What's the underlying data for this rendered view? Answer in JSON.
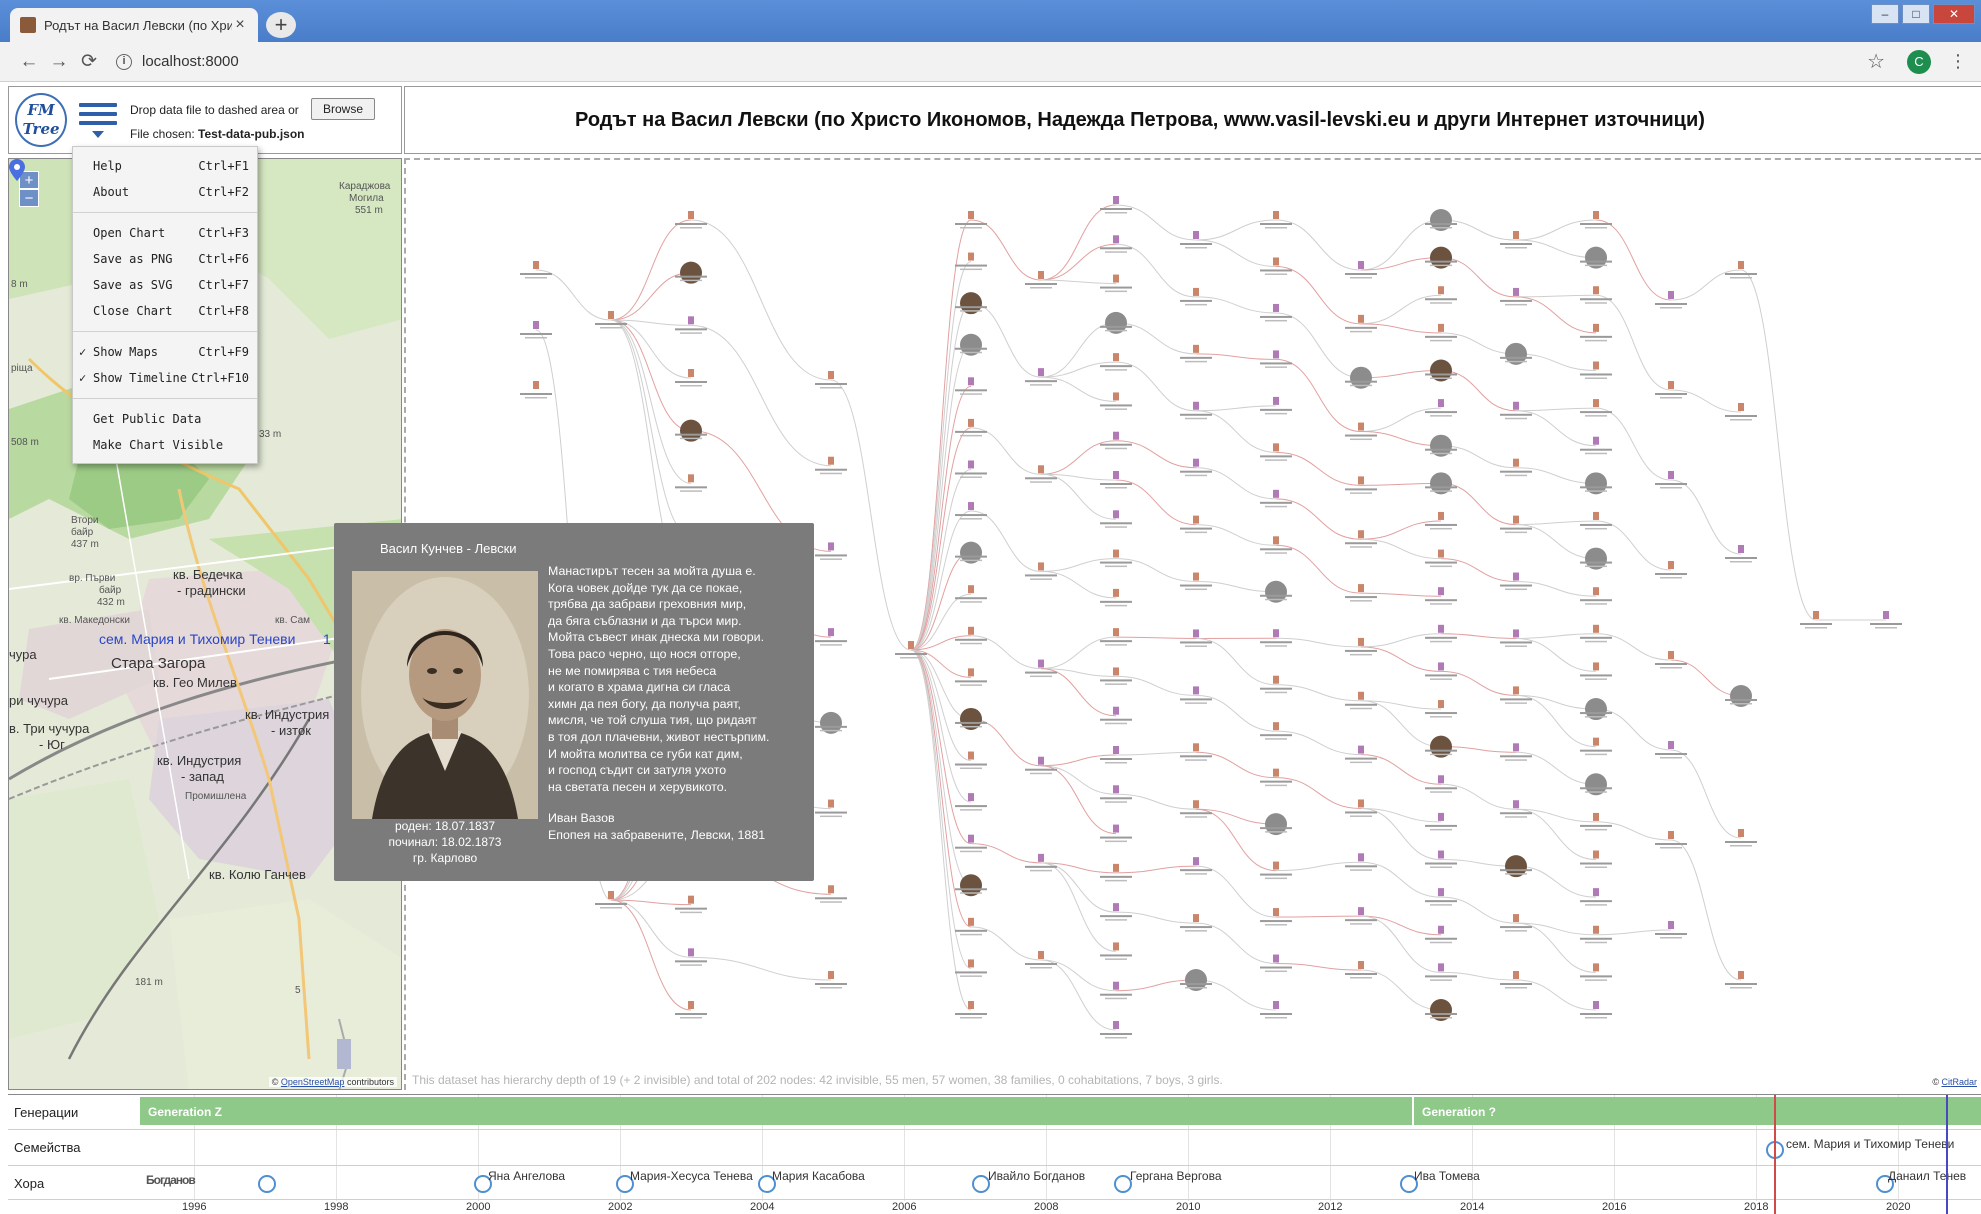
{
  "browser": {
    "tab_title": "Родът на Васил Левски (по Хри",
    "tab_close": "×",
    "new_tab": "+",
    "url": "localhost:8000",
    "profile_initial": "C",
    "minimize": "–",
    "maximize": "□",
    "close": "✕"
  },
  "header": {
    "logo_line1": "FM",
    "logo_line2": "Tree",
    "drop_hint": "Drop data file to dashed area or",
    "browse_label": "Browse",
    "file_chosen_label": "File chosen:",
    "file_chosen_value": "Test-data-pub.json",
    "title": "Родът на Васил Левски (по Христо Икономов, Надежда Петрова, www.vasil-levski.eu и други Интернет източници)"
  },
  "menu": {
    "items": [
      {
        "label": "Help",
        "shortcut": "Ctrl+F1",
        "checked": ""
      },
      {
        "label": "About",
        "shortcut": "Ctrl+F2",
        "checked": ""
      },
      {
        "label": "Open Chart",
        "shortcut": "Ctrl+F3",
        "checked": ""
      },
      {
        "label": "Save as PNG",
        "shortcut": "Ctrl+F6",
        "checked": ""
      },
      {
        "label": "Save as SVG",
        "shortcut": "Ctrl+F7",
        "checked": ""
      },
      {
        "label": "Close Chart",
        "shortcut": "Ctrl+F8",
        "checked": ""
      },
      {
        "label": "Show Maps",
        "shortcut": "Ctrl+F9",
        "checked": "✓"
      },
      {
        "label": "Show Timeline",
        "shortcut": "Ctrl+F10",
        "checked": "✓"
      },
      {
        "label": "Get Public Data",
        "shortcut": "",
        "checked": ""
      },
      {
        "label": "Make Chart Visible",
        "shortcut": "",
        "checked": ""
      }
    ]
  },
  "map": {
    "labels": {
      "karadzhova": "Караджова",
      "mogila": "Могила",
      "m551": "551 m",
      "m8": "8 m",
      "richa": "ріща",
      "m508": "508 m",
      "m33": "33 m",
      "vtori": "Втори",
      "bair": "байр",
      "m437": "437 m",
      "parvi": "вр. Първи",
      "bair2": "байр",
      "m432": "432 m",
      "bedechka": "кв. Бедечка",
      "gradinski": "- градински",
      "makedonski": "кв. Македонски",
      "sam": "кв. Сам",
      "family": "сем. Мария и Тихомир Теневи",
      "family_1": "1",
      "chura": "чура",
      "stara_zagora": "Стара Загора",
      "geo_milev": "кв. Гео Милев",
      "chuchura": "ри чучура",
      "tri_chuchura": "в. Три чучура",
      "yug": "- Юг",
      "industria_iztok": "кв. Индустрия",
      "iztok": "- изток",
      "industria_zapad": "кв. Индустрия",
      "zapad": "- запад",
      "promishlena": "Промишлена",
      "kolyu": "кв. Колю Ганчев",
      "m181": "181 m",
      "road5": "5"
    },
    "attribution_prefix": "©",
    "attribution_link": "OpenStreetMap",
    "attribution_suffix": "contributors",
    "zoom_in": "+",
    "zoom_out": "−"
  },
  "card": {
    "name": "Васил Кунчев - Левски",
    "born": "роден: 18.07.1837",
    "died": "починал: 18.02.1873",
    "place": "гр. Карлово",
    "poem": [
      "Манастирът тесен за мойта душа е.",
      "Кога човек дойде тук да се покае,",
      "трябва да забрави грехов­ния мир,",
      "да бяга съблазни и да търси мир.",
      "Мойта съвест инак днеска ми говори.",
      "Това расо черно, що нося отгоре,",
      "не ме помирява с тия небеса",
      "и когато в храма дигна си гласа",
      "химн да пея богу, да получа раят,",
      "мисля, че той слуша тия, що ридаят",
      "в тоя дол плачевни, живот нестърпим.",
      "И мойта молитва се губи кат дим,",
      "и господ съдит си затуля ухото",
      "на светата песен и херувикото."
    ],
    "ellipsis": "...",
    "author": "Иван Вазов",
    "source": "Епопея на забравените, Левски, 1881"
  },
  "chart": {
    "stats": "This dataset has hierarchy depth of 19 (+ 2 invisible) and total of 202 nodes: 42 invisible, 55 men, 57 women, 38 families, 0 cohabitations, 7 boys, 3 girls.",
    "attribution_prefix": "©",
    "attribution_link": "CitRadar"
  },
  "timeline": {
    "rows": {
      "generations": "Генерации",
      "families": "Семейства",
      "people": "Хора"
    },
    "generations": [
      "Generation Z",
      "Generation ?"
    ],
    "family_labels": [
      "сем. Мария и Тихомир Теневи"
    ],
    "people_labels": [
      "Яна Ангелова",
      "Мария-Хесуса Тенева",
      "Мария Касабова",
      "Ивайло Богданов",
      "Гергана Вергова",
      "Ива Томева",
      "Данаил Тенев"
    ],
    "overlap_label": "Богданов",
    "years": [
      "1996",
      "1998",
      "2000",
      "2002",
      "2004",
      "2006",
      "2008",
      "2010",
      "2012",
      "2014",
      "2016",
      "2018",
      "2020"
    ]
  }
}
